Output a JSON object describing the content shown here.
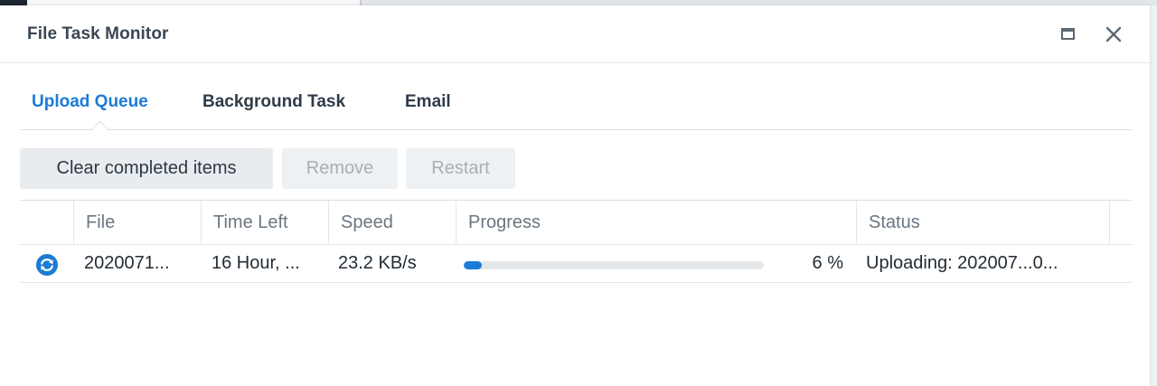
{
  "window": {
    "title": "File Task Monitor"
  },
  "tabs": [
    {
      "label": "Upload Queue",
      "active": true
    },
    {
      "label": "Background Task",
      "active": false
    },
    {
      "label": "Email",
      "active": false
    }
  ],
  "toolbar": {
    "clear_label": "Clear completed items",
    "remove_label": "Remove",
    "restart_label": "Restart"
  },
  "table": {
    "columns": [
      "File",
      "Time Left",
      "Speed",
      "Progress",
      "Status"
    ],
    "rows": [
      {
        "icon": "sync-icon",
        "file": "2020071...",
        "time_left": "16 Hour, ...",
        "speed": "23.2 KB/s",
        "progress": 0.06,
        "progress_text": "6 %",
        "status": "Uploading: 202007...0..."
      }
    ]
  },
  "colors": {
    "accent": "#1b7bd6",
    "title_text": "#3a4652",
    "track": "#e5e8eb"
  }
}
